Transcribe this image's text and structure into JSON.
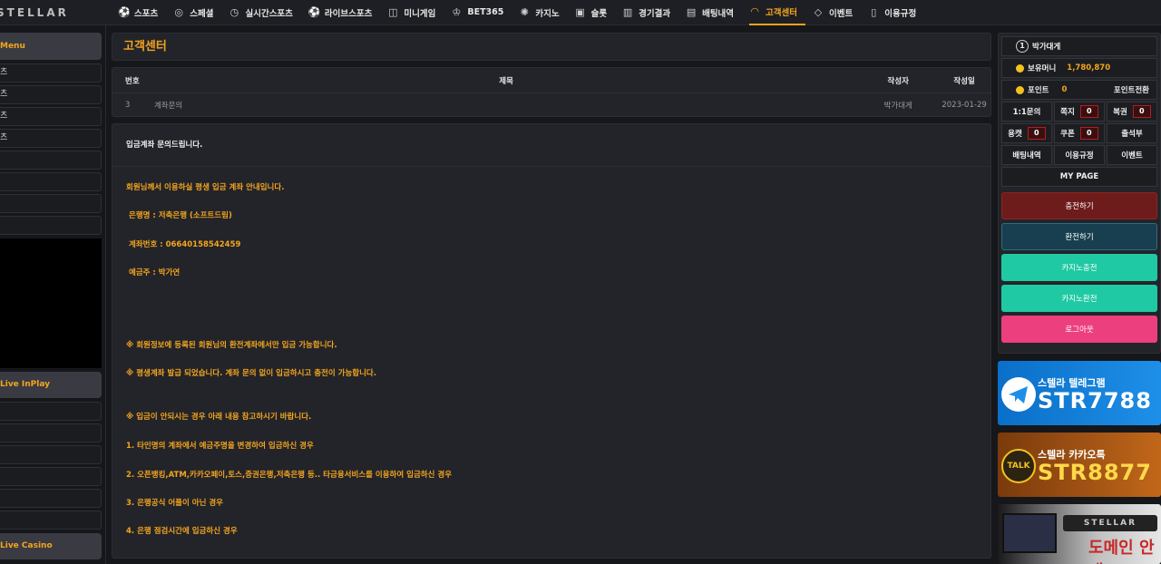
{
  "logo": "STELLAR",
  "nav": [
    {
      "label": "스포츠",
      "icon": "soccer-ball-icon"
    },
    {
      "label": "스페셜",
      "icon": "tennis-ball-icon"
    },
    {
      "label": "실시간스포츠",
      "icon": "clock-icon"
    },
    {
      "label": "라이브스포츠",
      "icon": "soccer-ball-icon"
    },
    {
      "label": "미니게임",
      "icon": "gamepad-icon"
    },
    {
      "label": "BET365",
      "icon": "trophy-icon"
    },
    {
      "label": "카지노",
      "icon": "sun-icon"
    },
    {
      "label": "슬롯",
      "icon": "cards-icon"
    },
    {
      "label": "경기결과",
      "icon": "bar-chart-icon"
    },
    {
      "label": "배팅내역",
      "icon": "receipt-icon"
    },
    {
      "label": "고객센터",
      "icon": "headset-icon",
      "active": true
    },
    {
      "label": "이벤트",
      "icon": "diamond-icon"
    },
    {
      "label": "이용규정",
      "icon": "document-icon"
    }
  ],
  "left": {
    "menu_label": "Menu",
    "rows": [
      "츠",
      "츠",
      "츠",
      "츠",
      "",
      "",
      "",
      ""
    ],
    "inplay_label": "Live InPlay",
    "inplay_rows": [
      "",
      "",
      "",
      "",
      "",
      ""
    ],
    "casino_label": "Live Casino"
  },
  "main": {
    "title": "고객센터",
    "headers": {
      "no": "번호",
      "subject": "제목",
      "author": "작성자",
      "date": "작성일"
    },
    "row": {
      "no": "3",
      "subject": "계좌문의",
      "author": "박가대게",
      "date": "2023-01-29"
    },
    "question": "입금계좌 문의드립니다.",
    "answer": [
      "회원님께서 이용하실 평생 입금 계좌 안내입니다.",
      "은행명 : 저축은행 (소프트드림)",
      "계좌번호 : 06640158542459",
      "예금주 : 박가연",
      "※ 회원정보에 등록된 회원님의 환전계좌에서만 입금 가능합니다.",
      "※ 평생계좌 발급 되었습니다. 계좌 문의 없이 입금하시고 충전이 가능합니다.",
      "※ 입금이 안되시는 경우 아래 내용 참고하시기 바랍니다.",
      "1. 타인명의 계좌에서 예금주명을 변경하여 입금하신 경우",
      "2. 오픈뱅킹,ATM,카카오페이,토스,증권은행,저축은행 등.. 타금융서비스를 이용하여 입금하신 경우",
      "3. 은행공식 어플이 아닌 경우",
      "4. 은행 점검시간에 입금하신 경우"
    ]
  },
  "right": {
    "user": "박가대게",
    "money_label": "보유머니",
    "money": "1,780,870",
    "point_label": "포인트",
    "point": "0",
    "point_convert": "포인트전환",
    "inquiry": "1:1문의",
    "note": "쪽지",
    "note_count": "0",
    "lotto": "복권",
    "lotto_count": "0",
    "recommend": "용캣",
    "recommend_count": "0",
    "coupon": "쿠폰",
    "coupon_count": "0",
    "attendance": "출석부",
    "bet_history": "배팅내역",
    "rules": "이용규정",
    "event": "이벤트",
    "mypage": "MY PAGE",
    "deposit": "충전하기",
    "withdraw": "환전하기",
    "casino_deposit": "카지노충전",
    "casino_withdraw": "카지노환전",
    "logout": "로그아웃",
    "colors": {
      "deposit": "#6e1b1b",
      "withdraw": "#173f4f",
      "casino": "#1fc9a3",
      "logout": "#ec3f7d"
    }
  },
  "banners": {
    "telegram_sub": "스텔라 텔레그램",
    "telegram_id": "STR7788",
    "kakao_sub": "스텔라 카카오톡",
    "kakao_badge": "TALK",
    "kakao_id": "STR8877",
    "domain_logo": "STELLAR",
    "domain_text": "도메인 안내"
  }
}
